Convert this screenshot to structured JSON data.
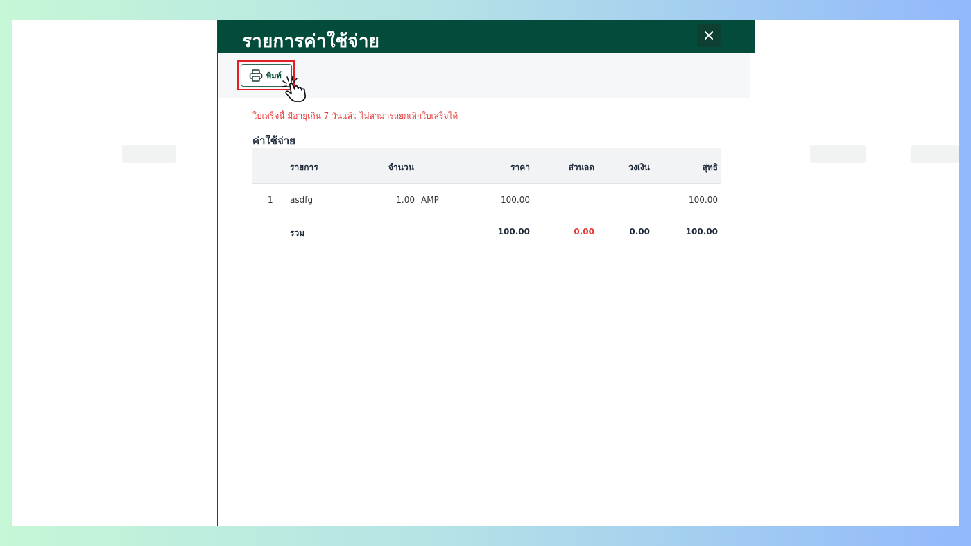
{
  "modal": {
    "title": "รายการค่าใช้จ่าย",
    "close_icon": "close-icon"
  },
  "toolbar": {
    "print_label": "พิมพ์",
    "print_icon": "printer-icon"
  },
  "warning": "ใบเสร็จนี้ มีอายุเกิน 7 วันแล้ว ไม่สามารถยกเลิกใบเสร็จได้",
  "section_title": "ค่าใช้จ่าย",
  "table": {
    "headers": {
      "item": "รายการ",
      "qty": "จำนวน",
      "price": "ราคา",
      "discount": "ส่วนลด",
      "limit": "วงเงิน",
      "net": "สุทธิ"
    },
    "rows": [
      {
        "no": "1",
        "item": "asdfg",
        "qty": "1.00",
        "unit": "AMP",
        "price": "100.00",
        "discount": "",
        "limit": "",
        "net": "100.00"
      }
    ],
    "total": {
      "label": "รวม",
      "price": "100.00",
      "discount": "0.00",
      "limit": "0.00",
      "net": "100.00"
    }
  },
  "colors": {
    "header_bg": "#034c3c",
    "warning": "#e53935",
    "highlight": "#e41e26"
  }
}
